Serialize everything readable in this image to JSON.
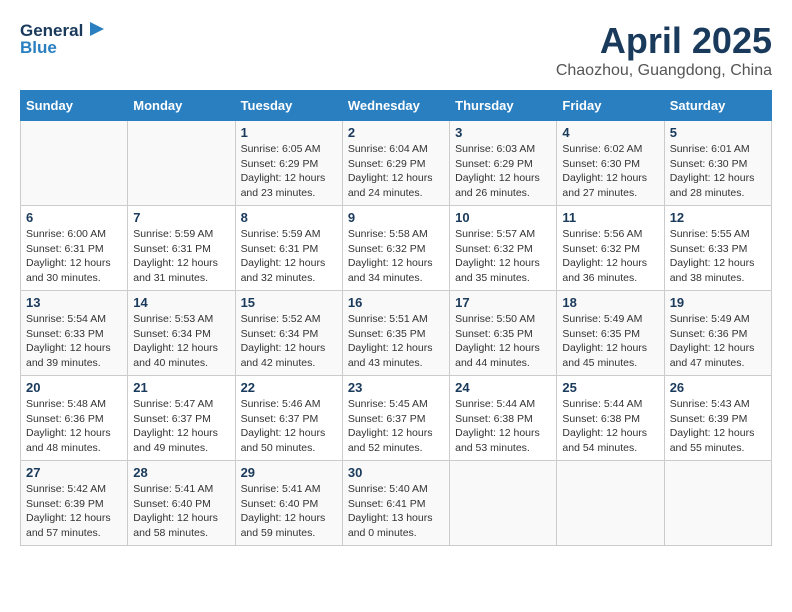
{
  "header": {
    "logo_line1": "General",
    "logo_line2": "Blue",
    "title": "April 2025",
    "subtitle": "Chaozhou, Guangdong, China"
  },
  "days_of_week": [
    "Sunday",
    "Monday",
    "Tuesday",
    "Wednesday",
    "Thursday",
    "Friday",
    "Saturday"
  ],
  "weeks": [
    [
      {
        "day": "",
        "info": ""
      },
      {
        "day": "",
        "info": ""
      },
      {
        "day": "1",
        "info": "Sunrise: 6:05 AM\nSunset: 6:29 PM\nDaylight: 12 hours and 23 minutes."
      },
      {
        "day": "2",
        "info": "Sunrise: 6:04 AM\nSunset: 6:29 PM\nDaylight: 12 hours and 24 minutes."
      },
      {
        "day": "3",
        "info": "Sunrise: 6:03 AM\nSunset: 6:29 PM\nDaylight: 12 hours and 26 minutes."
      },
      {
        "day": "4",
        "info": "Sunrise: 6:02 AM\nSunset: 6:30 PM\nDaylight: 12 hours and 27 minutes."
      },
      {
        "day": "5",
        "info": "Sunrise: 6:01 AM\nSunset: 6:30 PM\nDaylight: 12 hours and 28 minutes."
      }
    ],
    [
      {
        "day": "6",
        "info": "Sunrise: 6:00 AM\nSunset: 6:31 PM\nDaylight: 12 hours and 30 minutes."
      },
      {
        "day": "7",
        "info": "Sunrise: 5:59 AM\nSunset: 6:31 PM\nDaylight: 12 hours and 31 minutes."
      },
      {
        "day": "8",
        "info": "Sunrise: 5:59 AM\nSunset: 6:31 PM\nDaylight: 12 hours and 32 minutes."
      },
      {
        "day": "9",
        "info": "Sunrise: 5:58 AM\nSunset: 6:32 PM\nDaylight: 12 hours and 34 minutes."
      },
      {
        "day": "10",
        "info": "Sunrise: 5:57 AM\nSunset: 6:32 PM\nDaylight: 12 hours and 35 minutes."
      },
      {
        "day": "11",
        "info": "Sunrise: 5:56 AM\nSunset: 6:32 PM\nDaylight: 12 hours and 36 minutes."
      },
      {
        "day": "12",
        "info": "Sunrise: 5:55 AM\nSunset: 6:33 PM\nDaylight: 12 hours and 38 minutes."
      }
    ],
    [
      {
        "day": "13",
        "info": "Sunrise: 5:54 AM\nSunset: 6:33 PM\nDaylight: 12 hours and 39 minutes."
      },
      {
        "day": "14",
        "info": "Sunrise: 5:53 AM\nSunset: 6:34 PM\nDaylight: 12 hours and 40 minutes."
      },
      {
        "day": "15",
        "info": "Sunrise: 5:52 AM\nSunset: 6:34 PM\nDaylight: 12 hours and 42 minutes."
      },
      {
        "day": "16",
        "info": "Sunrise: 5:51 AM\nSunset: 6:35 PM\nDaylight: 12 hours and 43 minutes."
      },
      {
        "day": "17",
        "info": "Sunrise: 5:50 AM\nSunset: 6:35 PM\nDaylight: 12 hours and 44 minutes."
      },
      {
        "day": "18",
        "info": "Sunrise: 5:49 AM\nSunset: 6:35 PM\nDaylight: 12 hours and 45 minutes."
      },
      {
        "day": "19",
        "info": "Sunrise: 5:49 AM\nSunset: 6:36 PM\nDaylight: 12 hours and 47 minutes."
      }
    ],
    [
      {
        "day": "20",
        "info": "Sunrise: 5:48 AM\nSunset: 6:36 PM\nDaylight: 12 hours and 48 minutes."
      },
      {
        "day": "21",
        "info": "Sunrise: 5:47 AM\nSunset: 6:37 PM\nDaylight: 12 hours and 49 minutes."
      },
      {
        "day": "22",
        "info": "Sunrise: 5:46 AM\nSunset: 6:37 PM\nDaylight: 12 hours and 50 minutes."
      },
      {
        "day": "23",
        "info": "Sunrise: 5:45 AM\nSunset: 6:37 PM\nDaylight: 12 hours and 52 minutes."
      },
      {
        "day": "24",
        "info": "Sunrise: 5:44 AM\nSunset: 6:38 PM\nDaylight: 12 hours and 53 minutes."
      },
      {
        "day": "25",
        "info": "Sunrise: 5:44 AM\nSunset: 6:38 PM\nDaylight: 12 hours and 54 minutes."
      },
      {
        "day": "26",
        "info": "Sunrise: 5:43 AM\nSunset: 6:39 PM\nDaylight: 12 hours and 55 minutes."
      }
    ],
    [
      {
        "day": "27",
        "info": "Sunrise: 5:42 AM\nSunset: 6:39 PM\nDaylight: 12 hours and 57 minutes."
      },
      {
        "day": "28",
        "info": "Sunrise: 5:41 AM\nSunset: 6:40 PM\nDaylight: 12 hours and 58 minutes."
      },
      {
        "day": "29",
        "info": "Sunrise: 5:41 AM\nSunset: 6:40 PM\nDaylight: 12 hours and 59 minutes."
      },
      {
        "day": "30",
        "info": "Sunrise: 5:40 AM\nSunset: 6:41 PM\nDaylight: 13 hours and 0 minutes."
      },
      {
        "day": "",
        "info": ""
      },
      {
        "day": "",
        "info": ""
      },
      {
        "day": "",
        "info": ""
      }
    ]
  ]
}
